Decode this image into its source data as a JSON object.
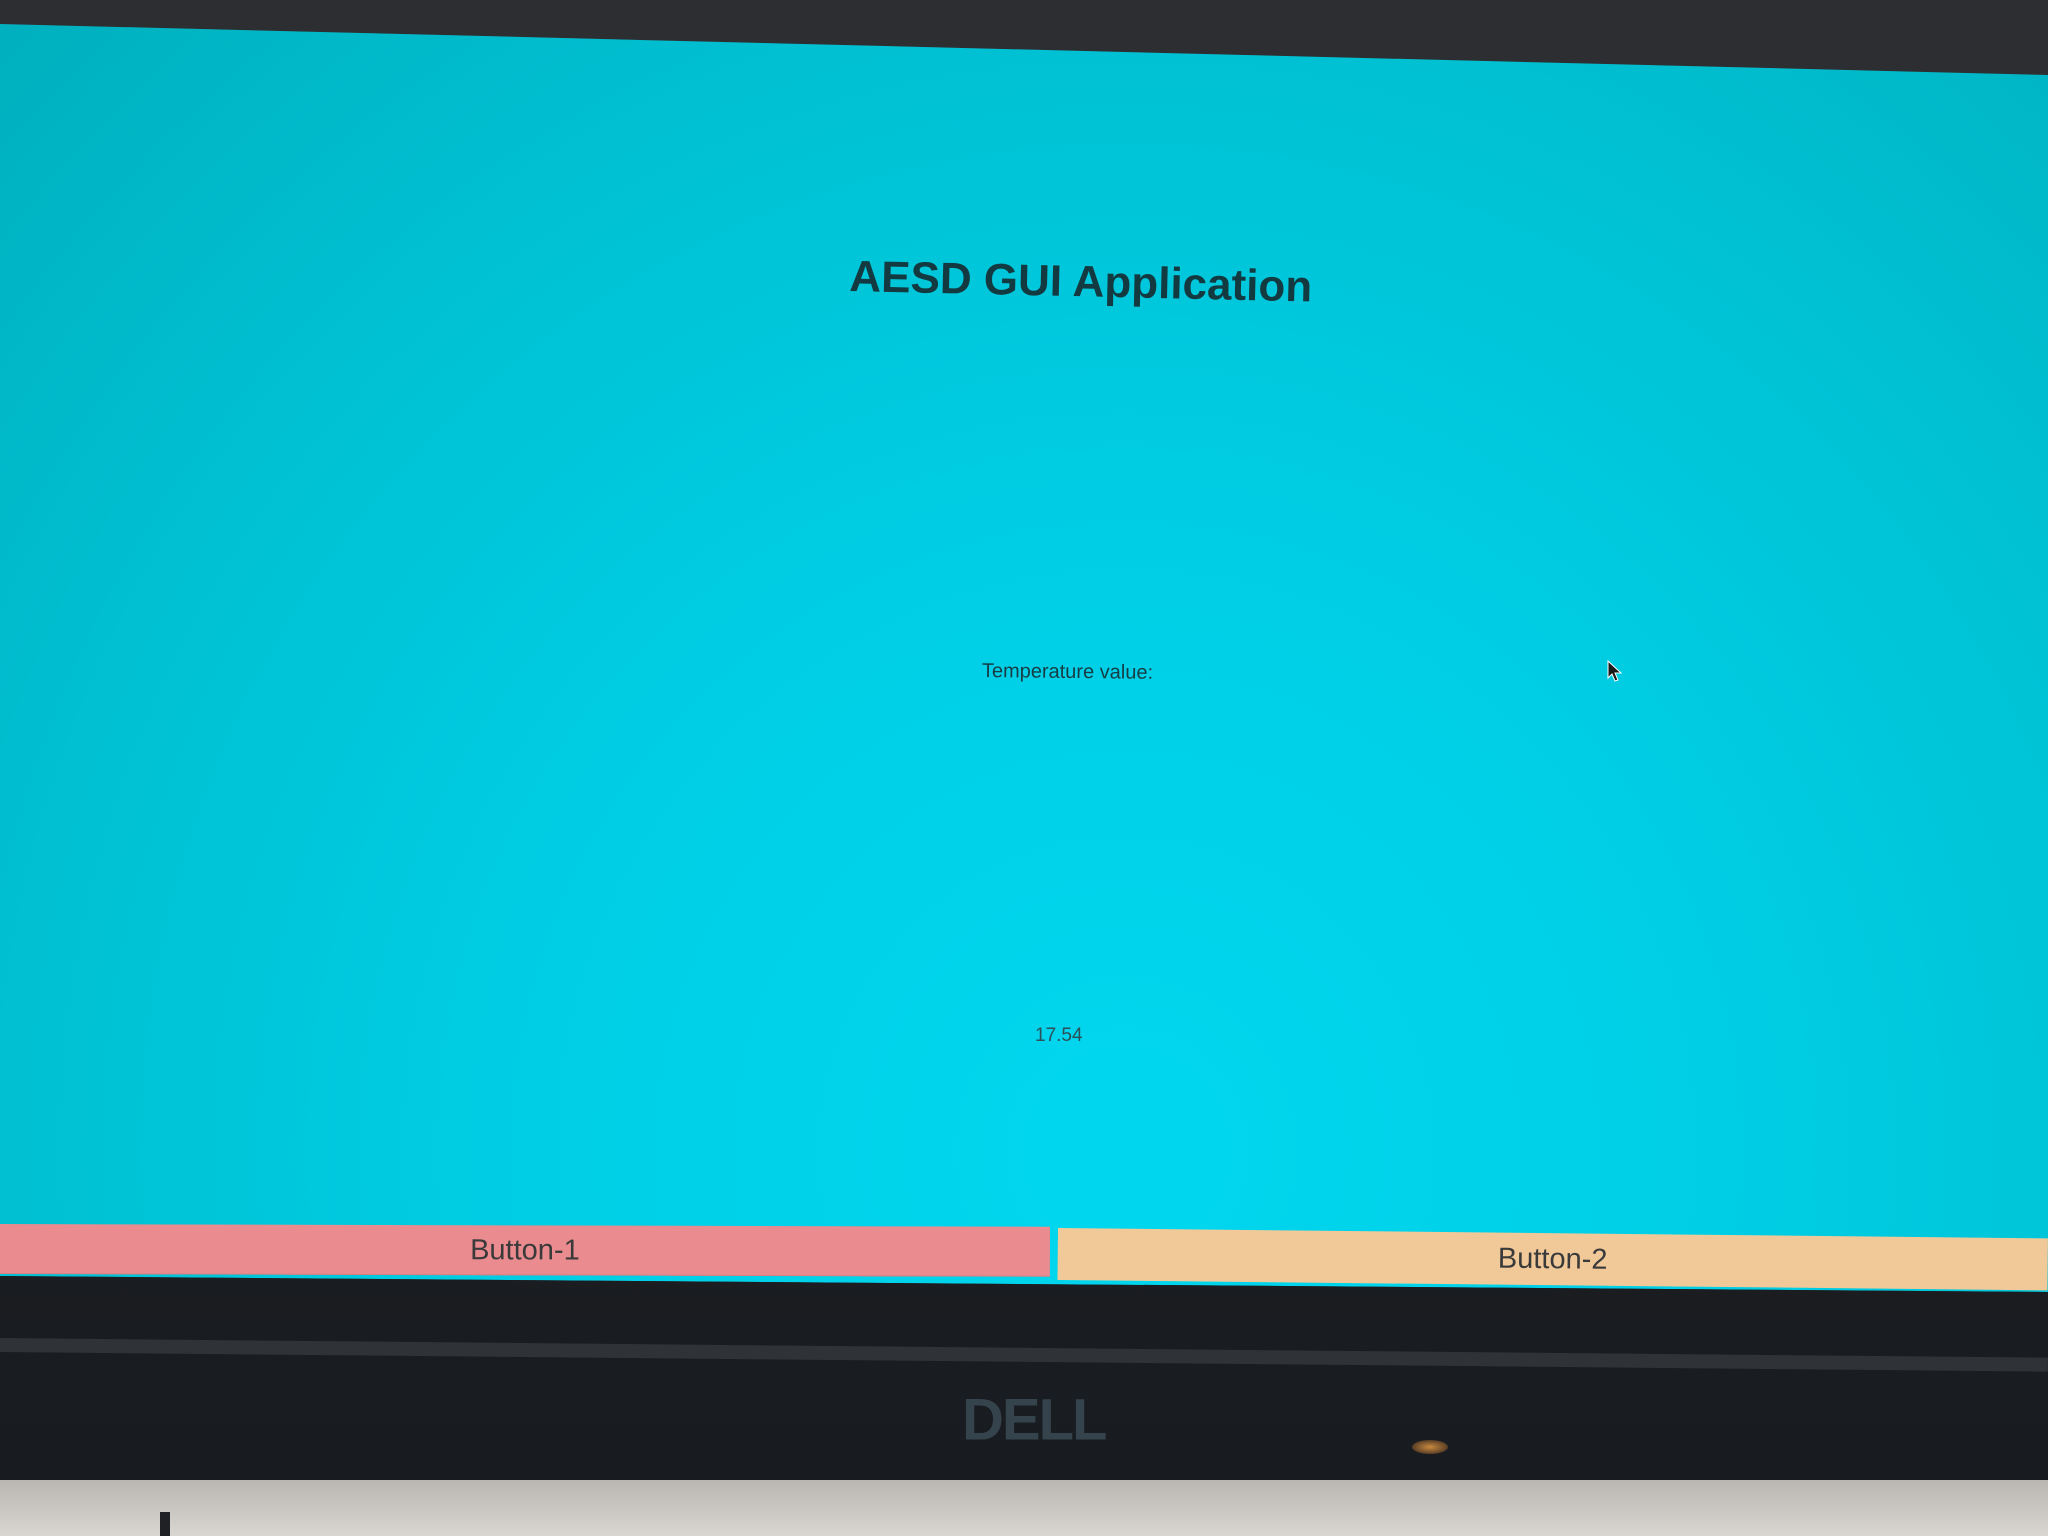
{
  "app": {
    "title": "AESD GUI Application",
    "temperature_label": "Temperature value:",
    "temperature_value": "17.54"
  },
  "buttons": {
    "button_1_label": "Button-1",
    "button_2_label": "Button-2"
  },
  "monitor": {
    "brand": "DELL"
  },
  "colors": {
    "background": "#00cfe6",
    "button_1": "#e98b8f",
    "button_2": "#f1c999",
    "title_text": "#133a40"
  }
}
